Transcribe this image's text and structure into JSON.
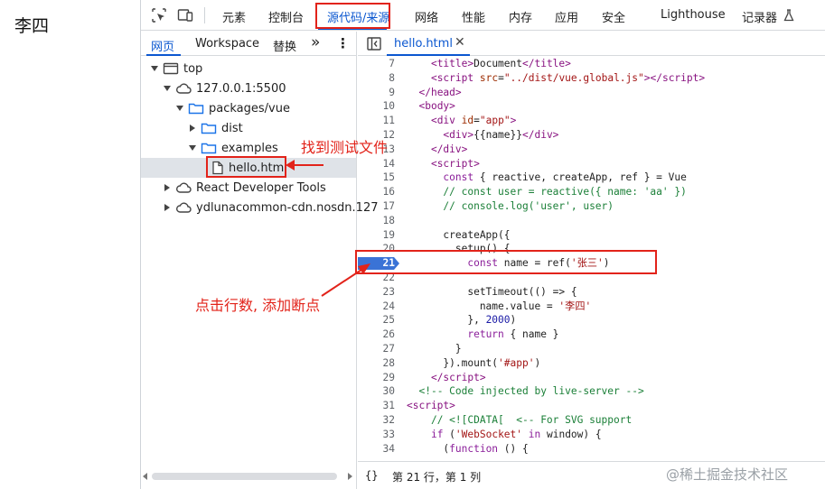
{
  "page": {
    "text": "李四"
  },
  "toolbar": {
    "tabs": [
      "元素",
      "控制台",
      "源代码/来源",
      "网络",
      "性能",
      "内存",
      "应用",
      "安全",
      "Lighthouse",
      "记录器"
    ],
    "active_tab": "源代码/来源"
  },
  "navigator": {
    "tabs": [
      "网页",
      "Workspace",
      "替换"
    ],
    "more_label": "»",
    "menu_label": "⋮",
    "tree": {
      "top": "top",
      "host": "127.0.0.1:5500",
      "folder_packages": "packages/vue",
      "folder_dist": "dist",
      "folder_examples": "examples",
      "file_hello": "hello.html",
      "react": "React Developer Tools",
      "cdn": "ydlunacommon-cdn.nosdn.127"
    }
  },
  "editor": {
    "file_tab": "hello.html",
    "close_label": "✕",
    "breakpoint_line": "21",
    "lines": [
      {
        "n": "7",
        "html": "    <span class='t'>&lt;title&gt;</span>Document<span class='t'>&lt;/title&gt;</span>"
      },
      {
        "n": "8",
        "html": "    <span class='t'>&lt;script</span> <span class='a'>src</span>=<span class='s'>\"../dist/vue.global.js\"</span><span class='t'>&gt;&lt;/script&gt;</span>"
      },
      {
        "n": "9",
        "html": "  <span class='t'>&lt;/head&gt;</span>"
      },
      {
        "n": "10",
        "html": "  <span class='t'>&lt;body&gt;</span>"
      },
      {
        "n": "11",
        "html": "    <span class='t'>&lt;div</span> <span class='a'>id</span>=<span class='s'>\"app\"</span><span class='t'>&gt;</span>"
      },
      {
        "n": "12",
        "html": "      <span class='t'>&lt;div&gt;</span>{{name}}<span class='t'>&lt;/div&gt;</span>"
      },
      {
        "n": "13",
        "html": "    <span class='t'>&lt;/div&gt;</span>"
      },
      {
        "n": "14",
        "html": "    <span class='t'>&lt;script&gt;</span>"
      },
      {
        "n": "15",
        "html": "      <span class='k'>const</span> { reactive, createApp, ref } = Vue"
      },
      {
        "n": "16",
        "html": "      <span class='c'>// const user = reactive({ name: 'aa' })</span>"
      },
      {
        "n": "17",
        "html": "      <span class='c'>// console.log('user', user)</span>"
      },
      {
        "n": "18",
        "html": ""
      },
      {
        "n": "19",
        "html": "      createApp({"
      },
      {
        "n": "20",
        "html": "        setup() {"
      },
      {
        "n": "21",
        "html": "          <span class='k'>const</span> name = ref(<span class='s'>'张三'</span>)"
      },
      {
        "n": "22",
        "html": ""
      },
      {
        "n": "23",
        "html": "          setTimeout(() =&gt; {"
      },
      {
        "n": "24",
        "html": "            name.value = <span class='s'>'李四'</span>"
      },
      {
        "n": "25",
        "html": "          }, <span class='n'>2000</span>)"
      },
      {
        "n": "26",
        "html": "          <span class='k'>return</span> { name }"
      },
      {
        "n": "27",
        "html": "        }"
      },
      {
        "n": "28",
        "html": "      }).mount(<span class='s'>'#app'</span>)"
      },
      {
        "n": "29",
        "html": "    <span class='t'>&lt;/script&gt;</span>"
      },
      {
        "n": "30",
        "html": "  <span class='c'>&lt;!-- Code injected by live-server --&gt;</span>"
      },
      {
        "n": "31",
        "html": "<span class='t'>&lt;script&gt;</span>"
      },
      {
        "n": "32",
        "html": "    <span class='c'>// &lt;![CDATA[  &lt;-- For SVG support</span>"
      },
      {
        "n": "33",
        "html": "    <span class='k'>if</span> (<span class='s'>'WebSocket'</span> <span class='k'>in</span> window) {"
      },
      {
        "n": "34",
        "html": "      (<span class='k'>function</span> () {"
      }
    ]
  },
  "status": {
    "brace": "{}",
    "text": "第 21 行，第 1 列"
  },
  "annotations": {
    "find_file": "找到测试文件",
    "click_line": "点击行数, 添加断点"
  },
  "watermark": "@稀土掘金技术社区",
  "colors": {
    "accent": "#0b57d0",
    "annotation": "#e2231a",
    "breakpoint": "#3a73d6"
  }
}
